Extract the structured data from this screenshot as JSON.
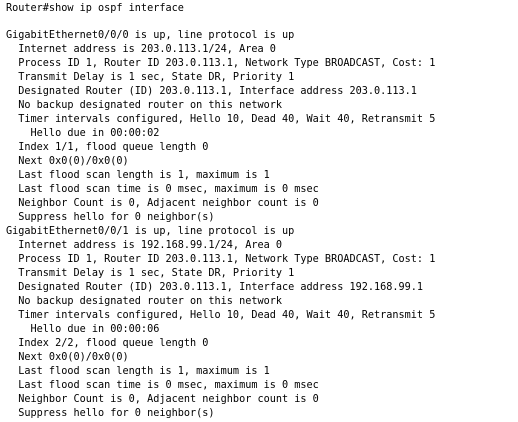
{
  "terminal": {
    "lines": [
      "Router#show ip ospf interface",
      "",
      "GigabitEthernet0/0/0 is up, line protocol is up",
      "  Internet address is 203.0.113.1/24, Area 0",
      "  Process ID 1, Router ID 203.0.113.1, Network Type BROADCAST, Cost: 1",
      "  Transmit Delay is 1 sec, State DR, Priority 1",
      "  Designated Router (ID) 203.0.113.1, Interface address 203.0.113.1",
      "  No backup designated router on this network",
      "  Timer intervals configured, Hello 10, Dead 40, Wait 40, Retransmit 5",
      "    Hello due in 00:00:02",
      "  Index 1/1, flood queue length 0",
      "  Next 0x0(0)/0x0(0)",
      "  Last flood scan length is 1, maximum is 1",
      "  Last flood scan time is 0 msec, maximum is 0 msec",
      "  Neighbor Count is 0, Adjacent neighbor count is 0",
      "  Suppress hello for 0 neighbor(s)",
      "GigabitEthernet0/0/1 is up, line protocol is up",
      "  Internet address is 192.168.99.1/24, Area 0",
      "  Process ID 1, Router ID 203.0.113.1, Network Type BROADCAST, Cost: 1",
      "  Transmit Delay is 1 sec, State DR, Priority 1",
      "  Designated Router (ID) 203.0.113.1, Interface address 192.168.99.1",
      "  No backup designated router on this network",
      "  Timer intervals configured, Hello 10, Dead 40, Wait 40, Retransmit 5",
      "    Hello due in 00:00:06",
      "  Index 2/2, flood queue length 0",
      "  Next 0x0(0)/0x0(0)",
      "  Last flood scan length is 1, maximum is 1",
      "  Last flood scan time is 0 msec, maximum is 0 msec",
      "  Neighbor Count is 0, Adjacent neighbor count is 0",
      "  Suppress hello for 0 neighbor(s)"
    ]
  }
}
